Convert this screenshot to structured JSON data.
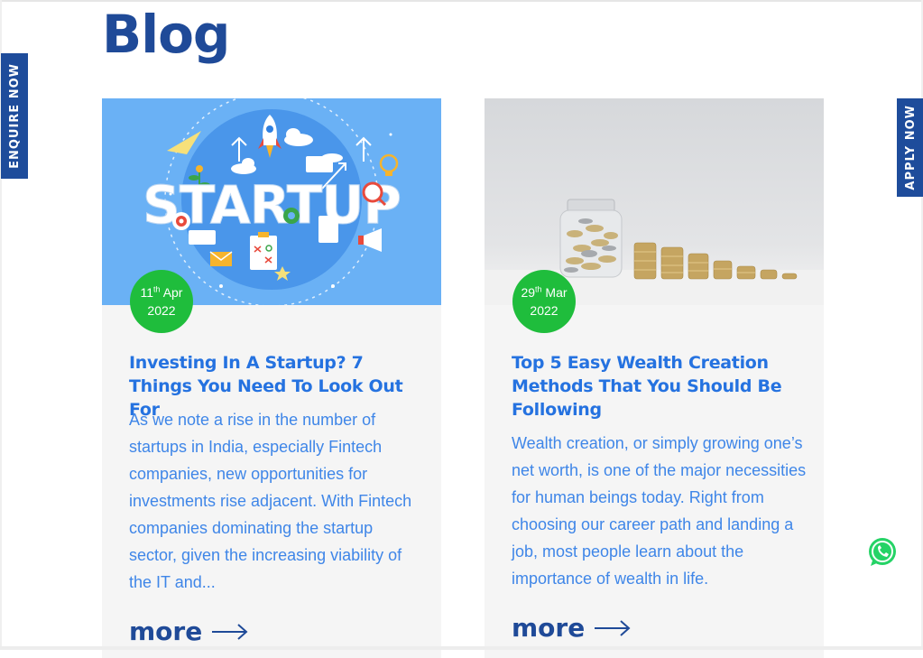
{
  "page": {
    "title": "Blog"
  },
  "side_tabs": {
    "enquire": "ENQUIRE NOW",
    "apply": "APPLY NOW"
  },
  "cards": [
    {
      "image_label": "STARTUP",
      "date": {
        "day": "11",
        "suffix": "th",
        "month": "Apr",
        "year": "2022"
      },
      "title": "Investing In A Startup? 7 Things You Need To Look Out For",
      "excerpt": "As we note a rise in the number of startups in India, especially Fintech companies, new opportunities for investments rise adjacent. With Fintech companies dominating the startup sector, given the increasing viability of the IT and...",
      "more_label": "more"
    },
    {
      "date": {
        "day": "29",
        "suffix": "th",
        "month": "Mar",
        "year": "2022"
      },
      "title": "Top 5 Easy Wealth Creation Methods That You Should Be Following",
      "excerpt": "Wealth creation, or simply growing one’s net worth, is one of the major necessities for human beings today. Right from choosing our career path and landing a job, most people learn about the importance of wealth in life.",
      "more_label": "more"
    }
  ],
  "colors": {
    "brand_blue": "#1f4a98",
    "title_blue": "#2572e0",
    "text_blue": "#3f86e8",
    "badge_green": "#1fbd3c",
    "whatsapp_green": "#25d366"
  },
  "icons": {
    "more_arrow": "long-arrow-right-icon",
    "whatsapp": "whatsapp-icon"
  }
}
